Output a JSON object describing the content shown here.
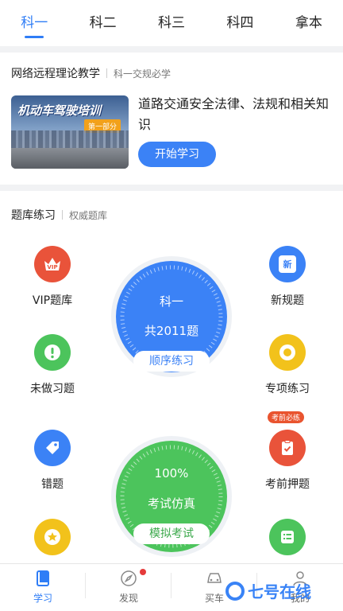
{
  "tabs": [
    {
      "label": "科一",
      "active": true
    },
    {
      "label": "科二"
    },
    {
      "label": "科三"
    },
    {
      "label": "科四"
    },
    {
      "label": "拿本"
    }
  ],
  "course_section": {
    "title": "网络远程理论教学",
    "subtitle": "科一交规必学",
    "banner_title": "机动车驾驶培训",
    "banner_tag": "第一部分",
    "course_title": "道路交通安全法律、法规和相关知识",
    "start_label": "开始学习"
  },
  "practice_section": {
    "title": "题库练习",
    "subtitle": "权威题库",
    "items": {
      "vip": {
        "label": "VIP题库",
        "icon": "vip-crown-icon",
        "color": "#e9533a"
      },
      "new": {
        "label": "新规题",
        "icon": "new-badge-icon",
        "color": "#3b82f6",
        "icon_text": "新"
      },
      "undone": {
        "label": "未做习题",
        "icon": "exclamation-icon",
        "color": "#4cc45c"
      },
      "special": {
        "label": "专项练习",
        "icon": "target-icon",
        "color": "#f2c21b"
      },
      "wrong": {
        "label": "错题",
        "icon": "tag-icon",
        "color": "#3b82f6"
      },
      "pre_exam": {
        "label": "考前押题",
        "icon": "clipboard-check-icon",
        "color": "#e9533a",
        "badge": "考前必练"
      },
      "star": {
        "icon": "star-icon",
        "color": "#f2c21b"
      },
      "list": {
        "icon": "list-icon",
        "color": "#4cc45c"
      }
    },
    "sequential": {
      "subject": "科一",
      "count": "共2011题",
      "button": "顺序练习",
      "color": "#3b82f6"
    },
    "mock": {
      "percent": "100%",
      "label": "考试仿真",
      "button": "模拟考试",
      "color": "#4cc45c"
    }
  },
  "bottom_nav": [
    {
      "label": "学习",
      "icon": "book-icon",
      "active": true
    },
    {
      "label": "发现",
      "icon": "compass-icon",
      "dot": true
    },
    {
      "label": "买车",
      "icon": "car-icon"
    },
    {
      "label": "我的",
      "icon": "user-icon"
    }
  ],
  "watermark": "七号在线",
  "colors": {
    "accent": "#2f7df6",
    "green": "#4cc45c",
    "red": "#e9533a",
    "yellow": "#f2c21b"
  }
}
